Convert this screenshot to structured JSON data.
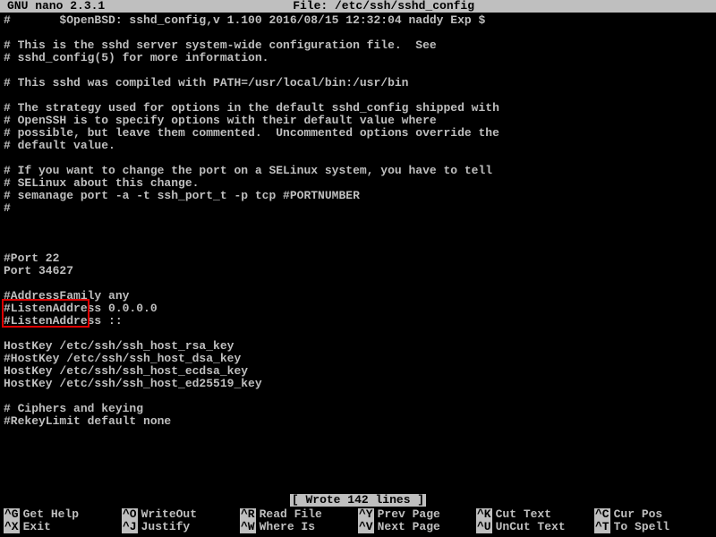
{
  "titlebar": {
    "app": "GNU nano 2.3.1",
    "file_label": "File: /etc/ssh/sshd_config"
  },
  "content_lines": [
    "#       $OpenBSD: sshd_config,v 1.100 2016/08/15 12:32:04 naddy Exp $",
    "",
    "# This is the sshd server system-wide configuration file.  See",
    "# sshd_config(5) for more information.",
    "",
    "# This sshd was compiled with PATH=/usr/local/bin:/usr/bin",
    "",
    "# The strategy used for options in the default sshd_config shipped with",
    "# OpenSSH is to specify options with their default value where",
    "# possible, but leave them commented.  Uncommented options override the",
    "# default value.",
    "",
    "# If you want to change the port on a SELinux system, you have to tell",
    "# SELinux about this change.",
    "# semanage port -a -t ssh_port_t -p tcp #PORTNUMBER",
    "#",
    "",
    "",
    "",
    "#Port 22",
    "Port 34627",
    "",
    "#AddressFamily any",
    "#ListenAddress 0.0.0.0",
    "#ListenAddress ::",
    "",
    "HostKey /etc/ssh/ssh_host_rsa_key",
    "#HostKey /etc/ssh/ssh_host_dsa_key",
    "HostKey /etc/ssh/ssh_host_ecdsa_key",
    "HostKey /etc/ssh/ssh_host_ed25519_key",
    "",
    "# Ciphers and keying",
    "#RekeyLimit default none"
  ],
  "status": {
    "message": "[ Wrote 142 lines ]"
  },
  "help": {
    "row1": [
      {
        "key": "^G",
        "label": "Get Help"
      },
      {
        "key": "^O",
        "label": "WriteOut"
      },
      {
        "key": "^R",
        "label": "Read File"
      },
      {
        "key": "^Y",
        "label": "Prev Page"
      },
      {
        "key": "^K",
        "label": "Cut Text"
      },
      {
        "key": "^C",
        "label": "Cur Pos"
      }
    ],
    "row2": [
      {
        "key": "^X",
        "label": "Exit"
      },
      {
        "key": "^J",
        "label": "Justify"
      },
      {
        "key": "^W",
        "label": "Where Is"
      },
      {
        "key": "^V",
        "label": "Next Page"
      },
      {
        "key": "^U",
        "label": "UnCut Text"
      },
      {
        "key": "^T",
        "label": "To Spell"
      }
    ]
  }
}
